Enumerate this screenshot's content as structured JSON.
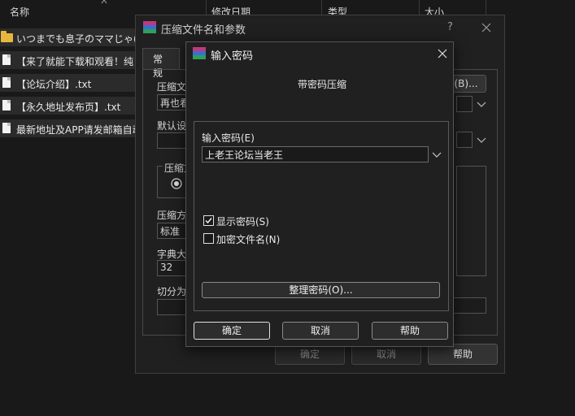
{
  "explorer": {
    "columns": [
      "名称",
      "修改日期",
      "类型",
      "大小"
    ],
    "files": [
      {
        "name": "いつまでも息子のママじゃ(",
        "type": "folder"
      },
      {
        "name": "【来了就能下载和观看！纯",
        "type": "doc"
      },
      {
        "name": "【论坛介绍】.txt",
        "type": "doc"
      },
      {
        "name": "【永久地址发布页】.txt",
        "type": "doc"
      },
      {
        "name": "最新地址及APP请发邮箱自动",
        "type": "doc"
      }
    ]
  },
  "archive_dialog": {
    "title": "压缩文件名和参数",
    "help_glyph": "?",
    "close_glyph": "×",
    "tab_general": "常规",
    "label_archive_name": "压缩文",
    "archive_name_value": "再也看",
    "browse_button": "(B)...",
    "label_default": "默认设",
    "label_format": "压缩文",
    "label_method": "压缩方",
    "method_value": "标准",
    "label_dict": "字典大",
    "dict_value": "32",
    "label_split": "切分为",
    "ok": "确定",
    "cancel": "取消",
    "help": "帮助"
  },
  "password_dialog": {
    "title": "输入密码",
    "close_glyph": "×",
    "heading": "带密码压缩",
    "enter_label": "输入密码(E)",
    "password_value": "上老王论坛当老王",
    "show_password_label": "显示密码(S)",
    "show_password_checked": true,
    "encrypt_names_label": "加密文件名(N)",
    "encrypt_names_checked": false,
    "organize_button": "整理密码(O)...",
    "ok": "确定",
    "cancel": "取消",
    "help": "帮助"
  },
  "colors": {
    "winrar_top": "#c03a7a",
    "winrar_mid": "#3a6fd1",
    "winrar_bot": "#2f9f5a"
  }
}
